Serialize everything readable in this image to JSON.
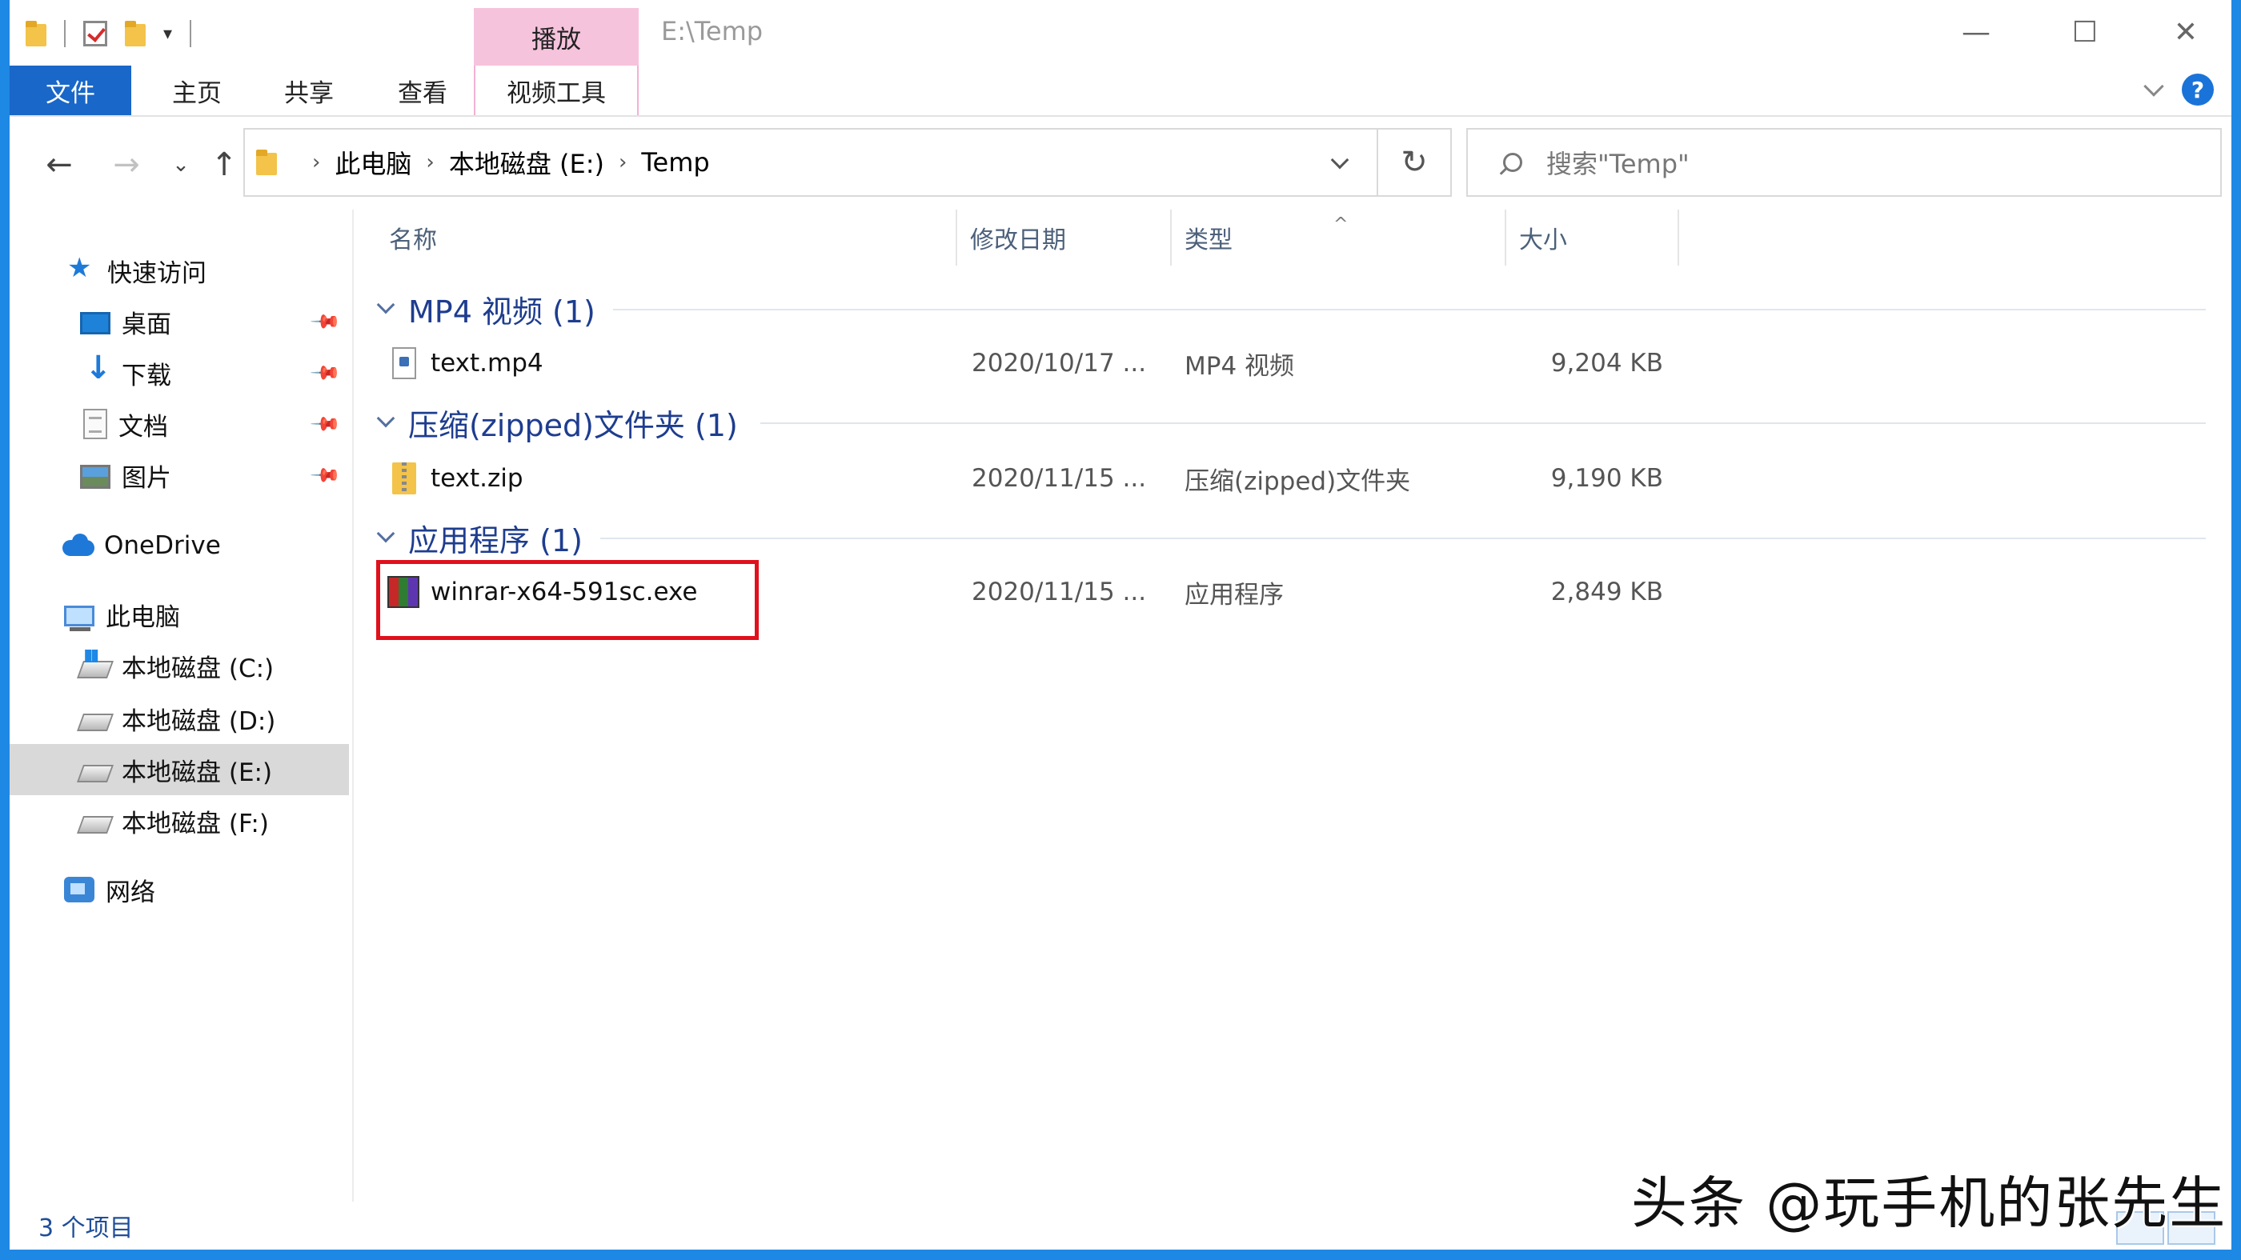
{
  "window": {
    "title": "E:\\Temp"
  },
  "ribbon": {
    "context_tab_header": "播放",
    "tabs": [
      {
        "label": "文件"
      },
      {
        "label": "主页"
      },
      {
        "label": "共享"
      },
      {
        "label": "查看"
      },
      {
        "label": "视频工具"
      }
    ]
  },
  "address": {
    "crumbs": [
      "此电脑",
      "本地磁盘 (E:)",
      "Temp"
    ]
  },
  "search": {
    "placeholder": "搜索\"Temp\""
  },
  "nav": {
    "quick_access": "快速访问",
    "pinned": [
      "桌面",
      "下载",
      "文档",
      "图片"
    ],
    "onedrive": "OneDrive",
    "this_pc": "此电脑",
    "drives": [
      "本地磁盘 (C:)",
      "本地磁盘 (D:)",
      "本地磁盘 (E:)",
      "本地磁盘 (F:)"
    ],
    "selected_drive": "本地磁盘 (E:)",
    "network": "网络"
  },
  "columns": {
    "name": "名称",
    "date": "修改日期",
    "type": "类型",
    "size": "大小"
  },
  "groups": [
    {
      "title": "MP4 视频 (1)",
      "files": [
        {
          "name": "text.mp4",
          "date": "2020/10/17 ...",
          "type": "MP4 视频",
          "size": "9,204 KB",
          "icon": "mp4-file-icon"
        }
      ]
    },
    {
      "title": "压缩(zipped)文件夹 (1)",
      "files": [
        {
          "name": "text.zip",
          "date": "2020/11/15 ...",
          "type": "压缩(zipped)文件夹",
          "size": "9,190 KB",
          "icon": "zip-file-icon"
        }
      ]
    },
    {
      "title": "应用程序 (1)",
      "files": [
        {
          "name": "winrar-x64-591sc.exe",
          "date": "2020/11/15 ...",
          "type": "应用程序",
          "size": "2,849 KB",
          "icon": "winrar-exe-icon",
          "highlighted": true
        }
      ]
    }
  ],
  "status": {
    "item_count": "3 个项目"
  },
  "watermark": "头条 @玩手机的张先生",
  "colors": {
    "accent": "#1967c8",
    "context_tab": "#f6c3dd",
    "highlight_box": "#e0101c",
    "group_title": "#1e3d8f"
  }
}
